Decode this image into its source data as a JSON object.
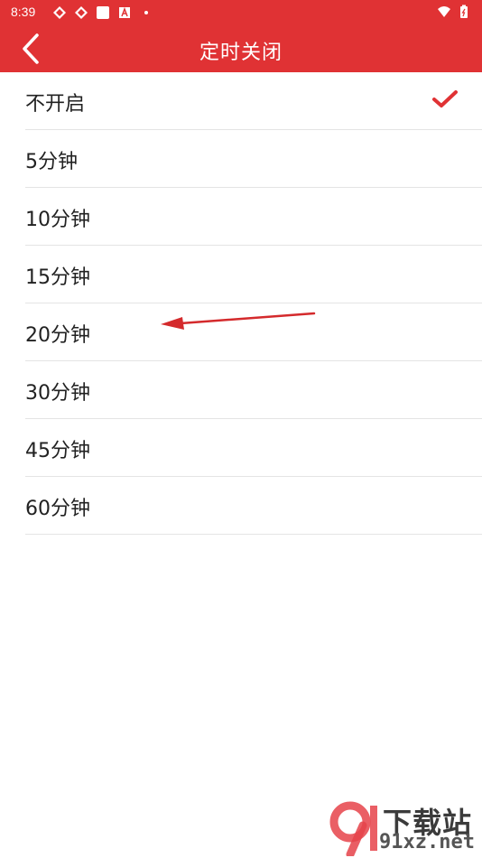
{
  "status_bar": {
    "time": "8:39",
    "icons": [
      "app-icon-1",
      "app-icon-2",
      "square-icon",
      "a-icon",
      "dot-icon"
    ],
    "right_icons": [
      "wifi-icon",
      "battery-icon"
    ]
  },
  "header": {
    "title": "定时关闭",
    "back_icon": "chevron-left-icon"
  },
  "options": [
    {
      "label": "不开启",
      "selected": true
    },
    {
      "label": "5分钟",
      "selected": false
    },
    {
      "label": "10分钟",
      "selected": false
    },
    {
      "label": "15分钟",
      "selected": false
    },
    {
      "label": "20分钟",
      "selected": false
    },
    {
      "label": "30分钟",
      "selected": false
    },
    {
      "label": "45分钟",
      "selected": false
    },
    {
      "label": "60分钟",
      "selected": false
    }
  ],
  "watermark": {
    "logo_text": "下载站",
    "domain": "91xz.net"
  },
  "colors": {
    "accent": "#e03234",
    "check": "#e03234",
    "divider": "#e4e4e4"
  }
}
